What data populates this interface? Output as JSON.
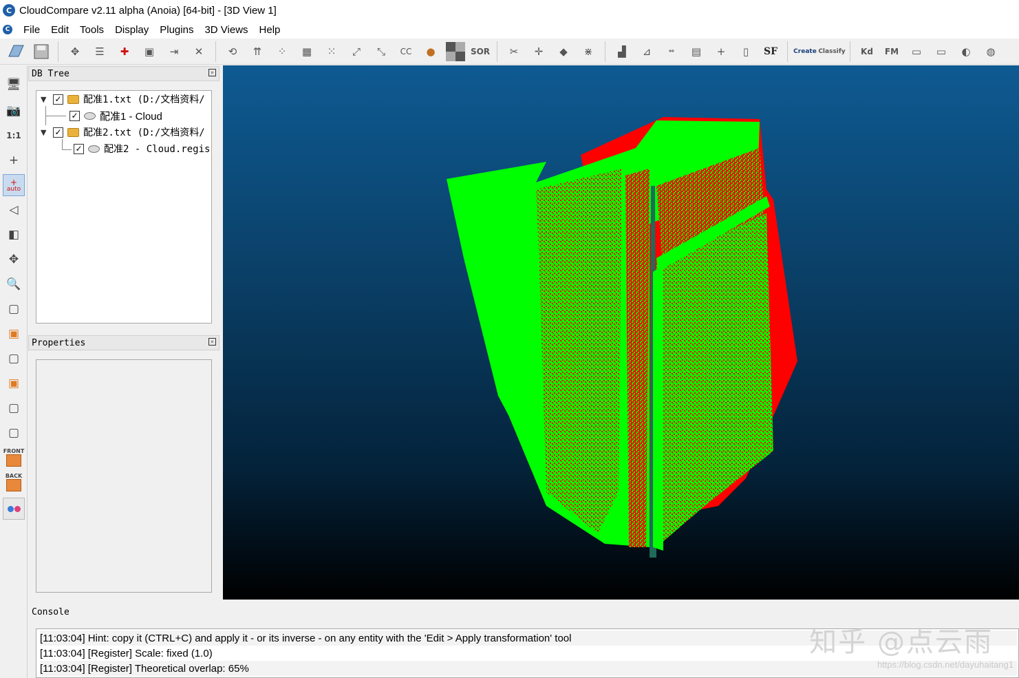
{
  "window": {
    "title": "CloudCompare v2.11 alpha (Anoia) [64-bit] - [3D View 1]",
    "logo_text": "C"
  },
  "menu": [
    "File",
    "Edit",
    "Tools",
    "Display",
    "Plugins",
    "3D Views",
    "Help"
  ],
  "toolbar": {
    "sor_label": "SOR",
    "sf_label": "SF",
    "canupo_create": "Create",
    "canupo_classify": "Classify",
    "kd_label": "Kd",
    "fm_label": "FM"
  },
  "vtoolbar": {
    "ratio_label": "1:1",
    "auto_label": "auto",
    "front_label": "FRONT",
    "back_label": "BACK"
  },
  "db_tree": {
    "title": "DB Tree",
    "items": [
      {
        "label": "配准1.txt (D:/文档资料/",
        "expanded": true,
        "checked": true
      },
      {
        "label": "配准1 - Cloud",
        "checked": true
      },
      {
        "label": "配准2.txt (D:/文档资料/",
        "expanded": true,
        "checked": true
      },
      {
        "label": "配准2 - Cloud.regis",
        "checked": true
      }
    ]
  },
  "properties": {
    "title": "Properties"
  },
  "console": {
    "title": "Console",
    "lines": [
      "[11:03:04] Hint: copy it (CTRL+C) and apply it - or its inverse - on any entity with the 'Edit > Apply transformation' tool",
      "[11:03:04] [Register] Scale: fixed (1.0)",
      "[11:03:04] [Register] Theoretical overlap: 65%"
    ]
  },
  "watermark": {
    "text": "知乎 @点云雨",
    "url": "https://blog.csdn.net/dayuhaitang1"
  },
  "colors": {
    "cloud1": "#00ff00",
    "cloud2": "#ff0000",
    "view_top": "#0e5a92",
    "view_bottom": "#000000"
  }
}
